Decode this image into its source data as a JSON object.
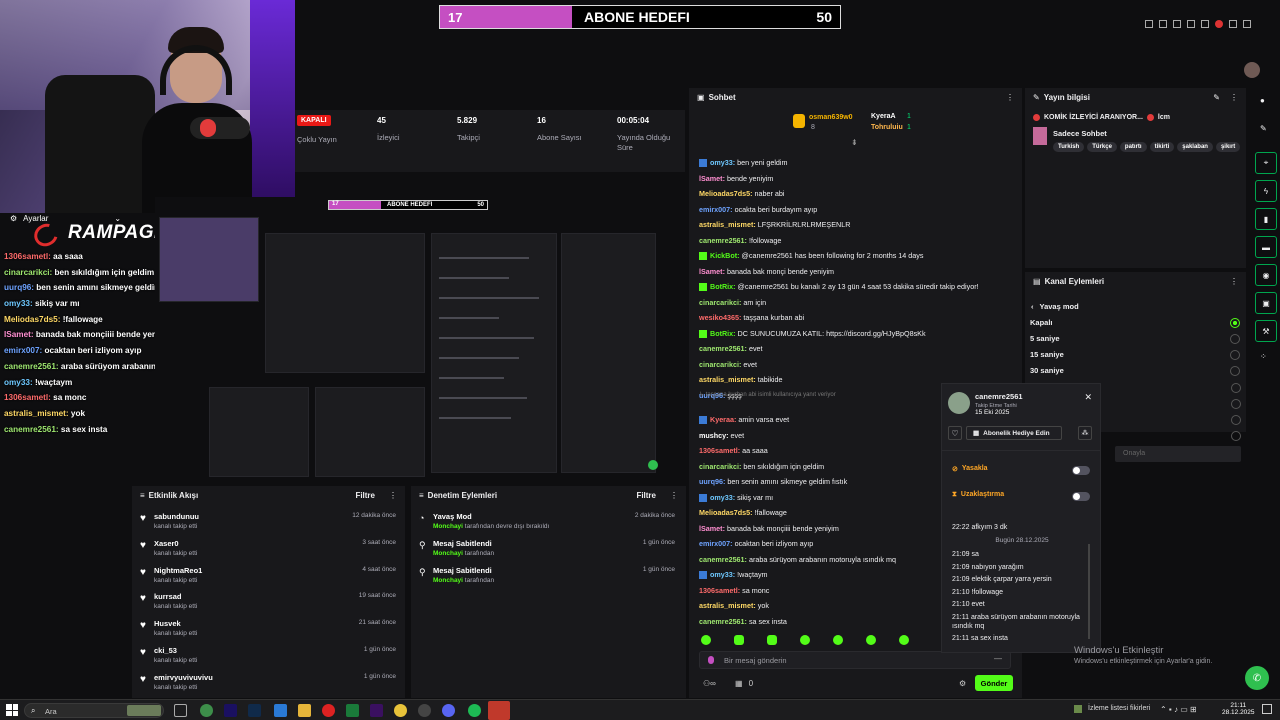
{
  "goal": {
    "current": "17",
    "title": "ABONE HEDEFI",
    "target": "50",
    "fill_fraction": 0.34
  },
  "overlay": {
    "settings_label": "Ayarlar",
    "brand": "RAMPAGE",
    "chat_lines": [
      {
        "user": "1306sametl:",
        "text": " aa saaa",
        "color": "#ff6b6b"
      },
      {
        "user": "cinarcarikci:",
        "text": " ben sıkıldığım için geldim",
        "color": "#9fe870"
      },
      {
        "user": "uurq96:",
        "text": " ben senin amını sikmeye geldim fıstık",
        "color": "#6ea3ff"
      },
      {
        "user": "omy33:",
        "text": " sikiş var mı",
        "color": "#6ec8ff"
      },
      {
        "user": "Meliodas7ds5:",
        "text": " !fallowage",
        "color": "#ffd966"
      },
      {
        "user": "lSamet:",
        "text": " banada bak monçiiii bende yeniyim",
        "color": "#ff8fd1"
      },
      {
        "user": "emirx007:",
        "text": " ocaktan beri izliyom ayıp",
        "color": "#6ea3ff"
      },
      {
        "user": "canemre2561:",
        "text": " araba sürüyom arabanın motoruyla ısındık mq",
        "color": "#9fe870"
      },
      {
        "user": "omy33:",
        "text": " !waçtaym",
        "color": "#6ec8ff"
      },
      {
        "user": "1306sametl:",
        "text": " sa monc",
        "color": "#ff6b6b"
      },
      {
        "user": "astralis_mismet:",
        "text": " yok",
        "color": "#ffd966"
      },
      {
        "user": "canemre2561:",
        "text": " sa sex insta",
        "color": "#9fe870"
      }
    ]
  },
  "stats": {
    "status_badge": "KAPALI",
    "multi_stream": "Çoklu Yayın",
    "items": [
      {
        "value": "45",
        "label": "İzleyici"
      },
      {
        "value": "5.829",
        "label": "Takipçi"
      },
      {
        "value": "16",
        "label": "Abone Sayısı"
      },
      {
        "value": "00:05:04",
        "label": "Yayında Olduğu Süre"
      }
    ]
  },
  "preview": {
    "goal_current": "17",
    "goal_title": "ABONE HEDEFI",
    "goal_target": "50"
  },
  "activity": {
    "title": "Etkinlik Akışı",
    "filter": "Filtre",
    "items": [
      {
        "name": "sabundunuu",
        "sub": "kanalı takip etti",
        "time": "12 dakika önce"
      },
      {
        "name": "Xaser0",
        "sub": "kanalı takip etti",
        "time": "3 saat önce"
      },
      {
        "name": "NightmaReo1",
        "sub": "kanalı takip etti",
        "time": "4 saat önce"
      },
      {
        "name": "kurrsad",
        "sub": "kanalı takip etti",
        "time": "19 saat önce"
      },
      {
        "name": "Husvek",
        "sub": "kanalı takip etti",
        "time": "21 saat önce"
      },
      {
        "name": "cki_53",
        "sub": "kanalı takip etti",
        "time": "1 gün önce"
      },
      {
        "name": "emirvyuvivuvivu",
        "sub": "kanalı takip etti",
        "time": "1 gün önce"
      }
    ]
  },
  "moderation": {
    "title": "Denetim Eylemleri",
    "filter": "Filtre",
    "items": [
      {
        "title": "Yavaş Mod",
        "by": "Monchayi",
        "desc": " tarafından devre dışı bırakıldı",
        "time": "2 dakika önce"
      },
      {
        "title": "Mesaj Sabitlendi",
        "by": "Monchayi",
        "desc": " tarafından",
        "time": "1 gün önce"
      },
      {
        "title": "Mesaj Sabitlendi",
        "by": "Monchayi",
        "desc": " tarafından",
        "time": "1 gün önce"
      }
    ]
  },
  "chat": {
    "title": "Sohbet",
    "top_gifters": {
      "first": "osman639w0",
      "first_count": "8",
      "second": "KyeraA",
      "second_count": "1",
      "third": "Tohruluiu",
      "third_count": "1"
    },
    "messages": [
      {
        "user": "omy33:",
        "text": " ben yeni geldim",
        "color": "#6ec8ff"
      },
      {
        "user": "lSamet:",
        "text": " bende yeniyim",
        "color": "#ff8fd1"
      },
      {
        "user": "Melioadas7ds5:",
        "text": " naber abi",
        "color": "#ffd966"
      },
      {
        "user": "emirx007:",
        "text": " ocakta beri burdayım ayıp",
        "color": "#6ea3ff"
      },
      {
        "user": "astralis_mismet:",
        "text": " LFŞRKRİLRLRLRMEŞENLR",
        "color": "#ffd966"
      },
      {
        "user": "canemre2561:",
        "text": " !followage",
        "color": "#9fe870"
      },
      {
        "user": "KickBot:",
        "text": " @canemre2561 has been following for 2 months 14 days",
        "color": "#53fc18"
      },
      {
        "user": "lSamet:",
        "text": " banada bak monçi bende yeniyim",
        "color": "#ff8fd1"
      },
      {
        "user": "BotRix:",
        "text": " @canemre2561 bu kanalı 2 ay 13 gün 4 saat 53 dakika süredir takip ediyor!",
        "color": "#53fc18"
      },
      {
        "user": "cinarcarikci:",
        "text": " am için",
        "color": "#9fe870"
      },
      {
        "user": "wesiko4365:",
        "text": " taşşana kurban abi",
        "color": "#ff6b6b"
      },
      {
        "user": "BotRix:",
        "text": " DC SUNUCUMUZA KATIL: https://discord.gg/HJyBpQ8sKk",
        "color": "#53fc18"
      },
      {
        "user": "canemre2561:",
        "text": " evet",
        "color": "#9fe870"
      },
      {
        "user": "cinarcarikci:",
        "text": " evet",
        "color": "#9fe870"
      },
      {
        "user": "astralis_mismet:",
        "text": " tabikide",
        "color": "#ffd966"
      },
      {
        "user": "uurq96:",
        "text": " şşşş",
        "color": "#6ea3ff"
      },
      {
        "user": "Kyeraa:",
        "text": " amin varsa evet",
        "color": "#ff6b6b"
      },
      {
        "user": "mushcy:",
        "text": " evet",
        "color": "#ffffff"
      },
      {
        "user": "1306sametl:",
        "text": " aa saaa",
        "color": "#ff6b6b"
      },
      {
        "user": "cinarcarikci:",
        "text": " ben sıkıldığım için geldim",
        "color": "#9fe870"
      },
      {
        "user": "uurq96:",
        "text": " ben senin amını sikmeye geldim fıstık",
        "color": "#6ea3ff"
      },
      {
        "user": "omy33:",
        "text": " sikiş var mı",
        "color": "#6ec8ff"
      },
      {
        "user": "Melioadas7ds5:",
        "text": " !fallowage",
        "color": "#ffd966"
      },
      {
        "user": "lSamet:",
        "text": " banada bak monçiiii bende yeniyim",
        "color": "#ff8fd1"
      },
      {
        "user": "emirx007:",
        "text": " ocaktan beri izliyom ayıp",
        "color": "#6ea3ff"
      },
      {
        "user": "canemre2561:",
        "text": " araba sürüyom arabanın motoruyla ısındık mq",
        "color": "#9fe870"
      },
      {
        "user": "omy33:",
        "text": " !waçtaym",
        "color": "#6ec8ff"
      },
      {
        "user": "1306sametl:",
        "text": " sa monc",
        "color": "#ff6b6b"
      },
      {
        "user": "astralis_mismet:",
        "text": " yok",
        "color": "#ffd966"
      },
      {
        "user": "canemre2561:",
        "text": " sa sex insta",
        "color": "#9fe870"
      }
    ],
    "reply_hint": "taşşana kurban abi isimli kullanıcıya yanıt veriyor",
    "input_placeholder": "Bir mesaj gönderin",
    "send_label": "Gönder",
    "points": "0"
  },
  "info": {
    "title": "Yayın bilgisi",
    "stream_title": "KOMİK İZLEYİCİ ARANIYOR...",
    "stream_title_suffix": "lcm",
    "category": "Sadece Sohbet",
    "tags": [
      "Turkish",
      "Türkçe",
      "patırtı",
      "tikirti",
      "şaklaban",
      "şikırt"
    ]
  },
  "channel_actions": {
    "title": "Kanal Eylemleri",
    "back_label": "Yavaş mod",
    "options": [
      "Kapalı",
      "5 saniye",
      "15 saniye",
      "30 saniye"
    ],
    "selected_index": 0,
    "confirm_label": "Onayla"
  },
  "usercard": {
    "username": "canemre2561",
    "follow_label": "Takip Etme Tarihi",
    "follow_date": "15 Eki 2025",
    "gift_label": "Abonelik Hediye Edin",
    "ban_label": "Yasakla",
    "timeout_label": "Uzaklaştırma",
    "history_top": "22:22 afkyım 3 dk",
    "date_divider": "Bugün 28.12.2025",
    "history": [
      "21:09 sa",
      "21:09 nabıyon yarağım",
      "21:09 elektik çarpar yarra yersin",
      "21:10 !followage",
      "21:10 evet",
      "21:11 araba sürüyom arabanın motoruyla ısındık mq",
      "21:11 sa sex insta"
    ]
  },
  "watermark": {
    "line1": "Windows'u Etkinleştir",
    "line2": "Windows'u etkinleştirmek için Ayarlar'a gidin."
  },
  "taskbar": {
    "search_placeholder": "Ara",
    "tray_text": "İzleme listesi fikirleri",
    "time": "21:11",
    "date": "28.12.2025"
  }
}
